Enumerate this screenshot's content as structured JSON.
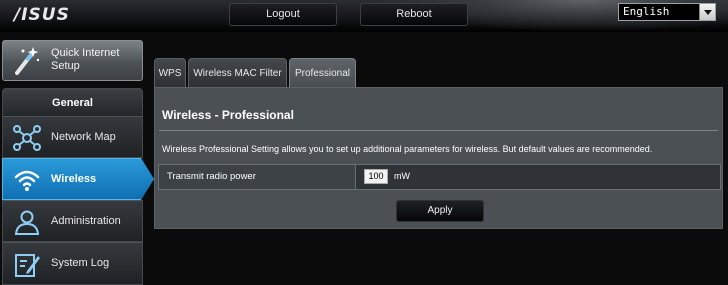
{
  "header": {
    "logo": "/ISUS",
    "logout_label": "Logout",
    "reboot_label": "Reboot",
    "language": "English"
  },
  "sidebar": {
    "quick_setup_label": "Quick Internet Setup",
    "section_title": "General",
    "items": [
      {
        "label": "Network Map",
        "icon": "network-map-icon"
      },
      {
        "label": "Wireless",
        "icon": "wireless-icon",
        "active": true
      },
      {
        "label": "Administration",
        "icon": "administration-icon"
      },
      {
        "label": "System Log",
        "icon": "system-log-icon"
      }
    ]
  },
  "tabs": [
    {
      "label": "WPS"
    },
    {
      "label": "Wireless MAC Filter"
    },
    {
      "label": "Professional",
      "active": true
    }
  ],
  "panel": {
    "title": "Wireless - Professional",
    "description": "Wireless Professional Setting allows you to set up additional parameters for wireless. But default values are recommended.",
    "field_label": "Transmit radio power",
    "field_value": "100",
    "field_unit": "mW",
    "apply_label": "Apply"
  },
  "colors": {
    "background": "#0b0b0c",
    "active_nav": "#1a84c8",
    "panel": "#4b5054"
  }
}
